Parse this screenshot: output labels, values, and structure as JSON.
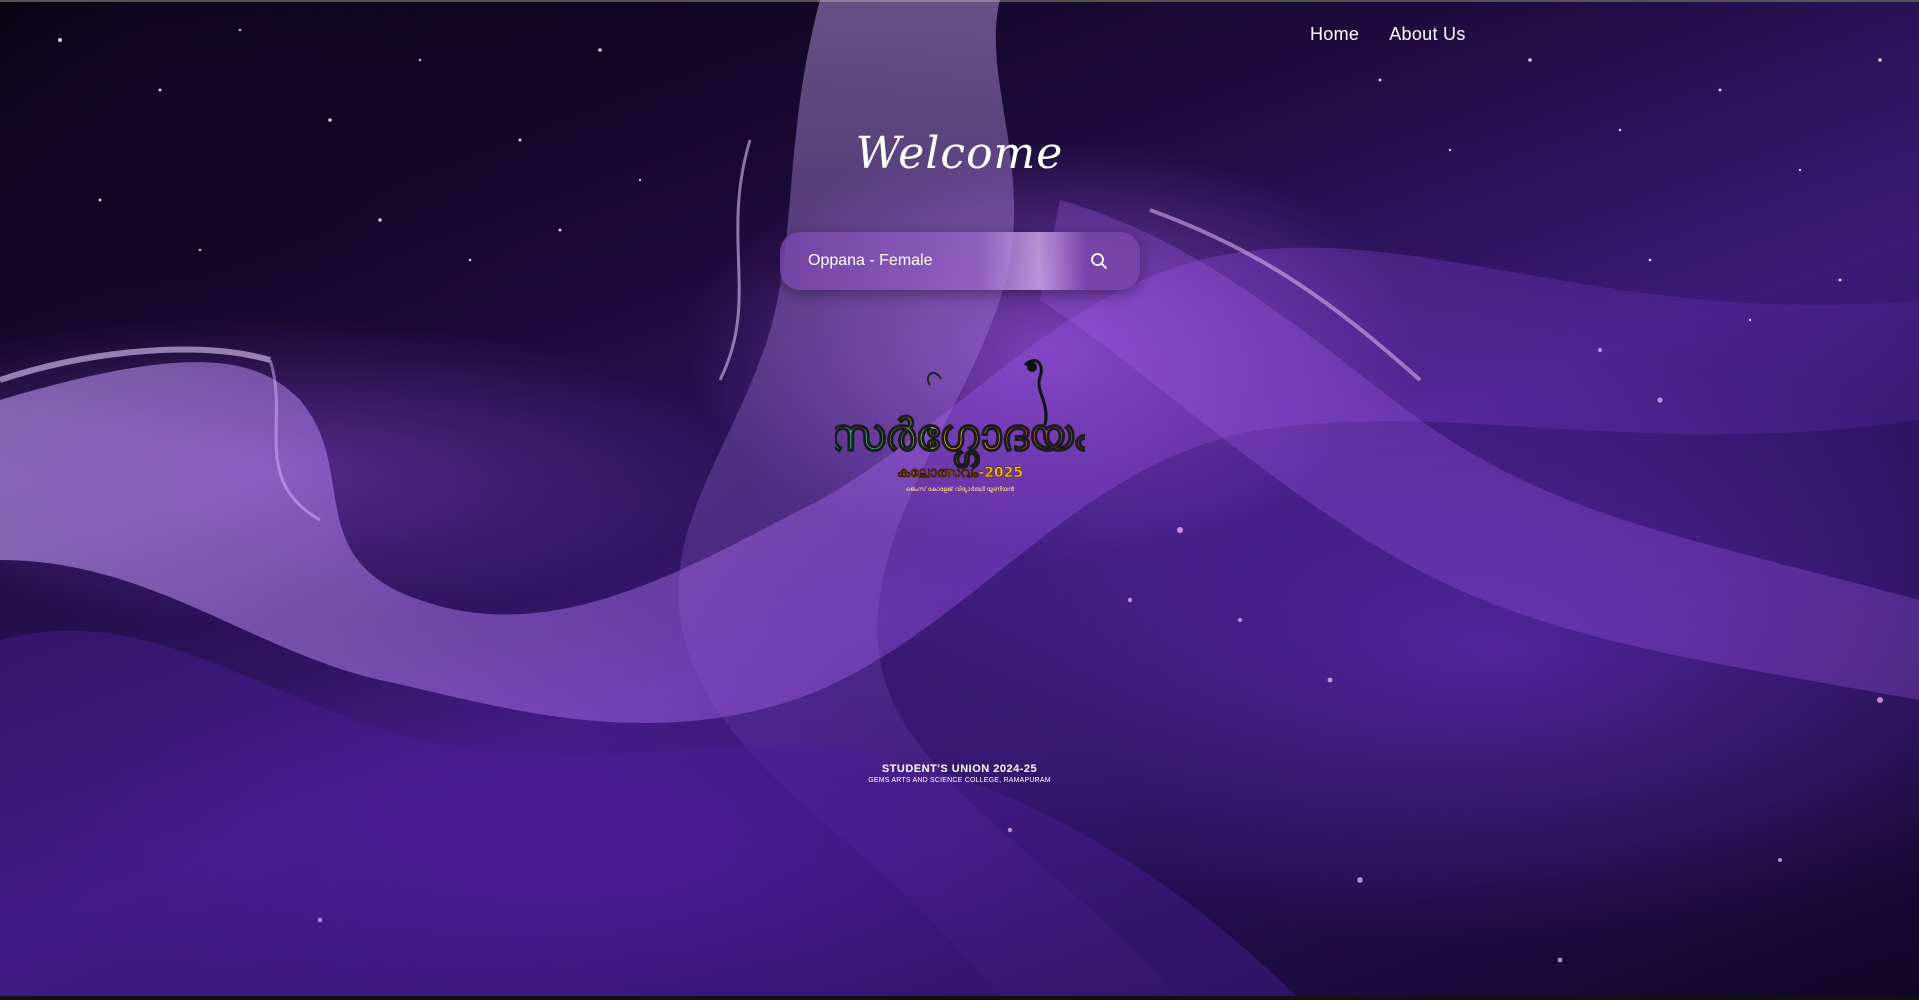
{
  "nav": {
    "home": "Home",
    "about": "About Us"
  },
  "hero": {
    "title": "Welcome"
  },
  "search": {
    "value": "Oppana - Female",
    "icon": "search-icon"
  },
  "logo": {
    "title_text": "സർഗ്ഗോദയം",
    "subtitle_text": "കലോത്സവം-2025",
    "tagline_text": "ജെംസ് കോളേജ് വിദ്യാർത്ഥി യൂണിയൻ"
  },
  "footer": {
    "union_title": "STUDENT'S UNION 2024-25",
    "college": "GEMS ARTS AND SCIENCE COLLEGE, RAMAPURAM"
  },
  "colors": {
    "background_primary": "#3b1a78",
    "accent": "#b866ff",
    "text": "#ffffff"
  }
}
